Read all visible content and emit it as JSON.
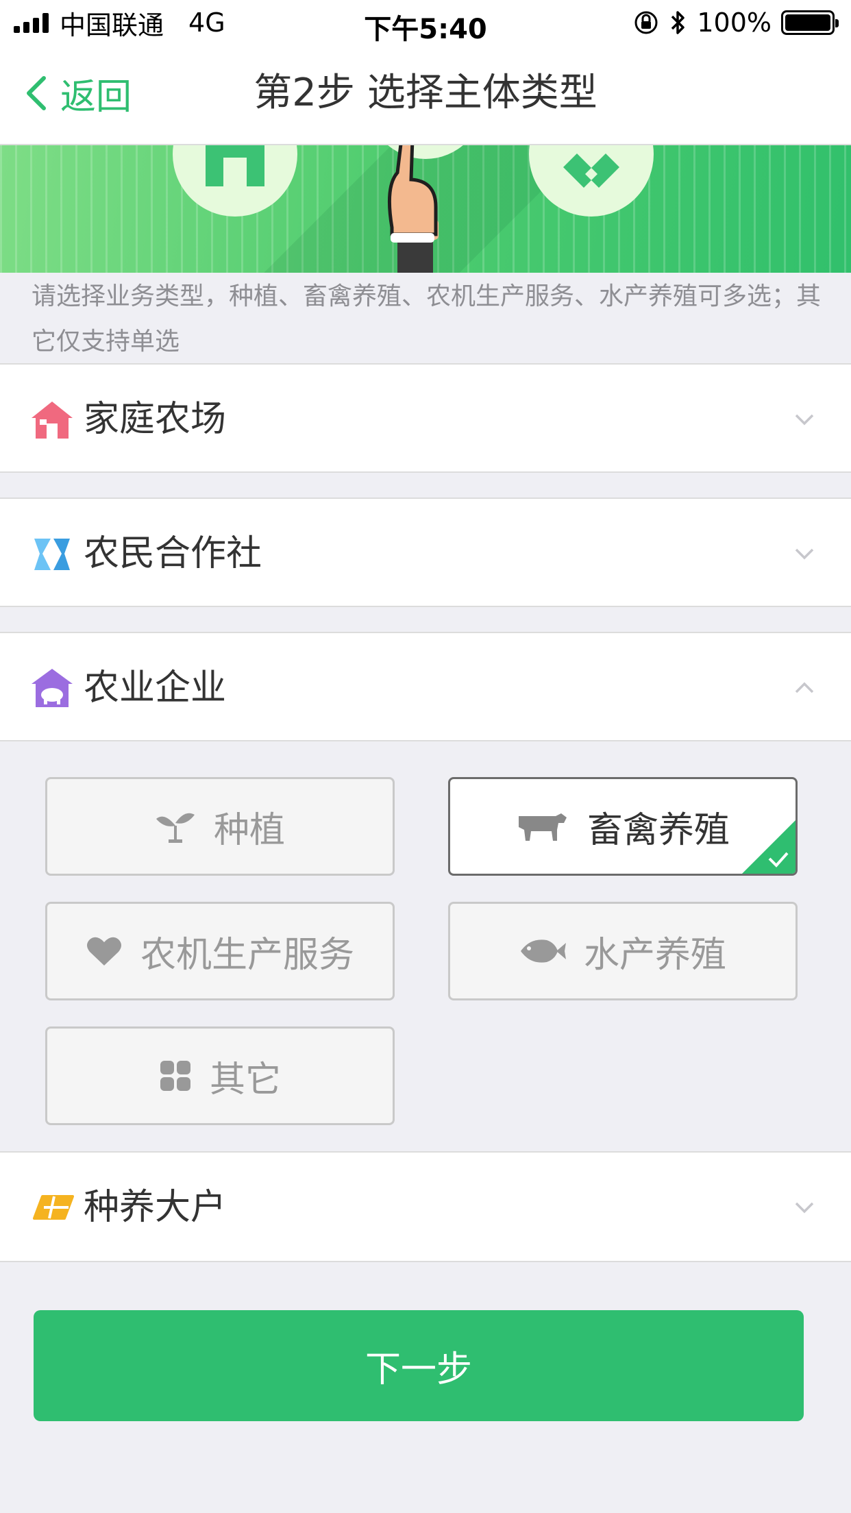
{
  "status_bar": {
    "carrier": "中国联通",
    "network": "4G",
    "time": "下午5:40",
    "battery": "100%",
    "icons": [
      "signal-icon",
      "rotation-lock-icon",
      "bluetooth-icon",
      "battery-icon"
    ]
  },
  "nav": {
    "back_label": "返回",
    "title": "第2步 选择主体类型"
  },
  "hint": "请选择业务类型，种植、畜禽养殖、农机生产服务、水产养殖可多选；其它仅支持单选",
  "sections": [
    {
      "label": "家庭农场",
      "icon": "house-icon",
      "icon_color": "#f0697f",
      "expanded": false
    },
    {
      "label": "农民合作社",
      "icon": "cooperative-icon",
      "icon_color": "#5ab4f0",
      "expanded": false
    },
    {
      "label": "农业企业",
      "icon": "pig-barn-icon",
      "icon_color": "#9b6de0",
      "expanded": true
    },
    {
      "label": "种养大户",
      "icon": "field-icon",
      "icon_color": "#f5b320",
      "expanded": false
    }
  ],
  "options": [
    {
      "label": "种植",
      "icon": "sprout-icon",
      "selected": false
    },
    {
      "label": "畜禽养殖",
      "icon": "cow-icon",
      "selected": true
    },
    {
      "label": "农机生产服务",
      "icon": "heart-icon",
      "selected": false
    },
    {
      "label": "水产养殖",
      "icon": "fish-icon",
      "selected": false
    },
    {
      "label": "其它",
      "icon": "grid-icon",
      "selected": false
    }
  ],
  "next_button": "下一步",
  "colors": {
    "accent": "#2fbe70",
    "background": "#efeff4",
    "hint_text": "#8e8e93"
  }
}
